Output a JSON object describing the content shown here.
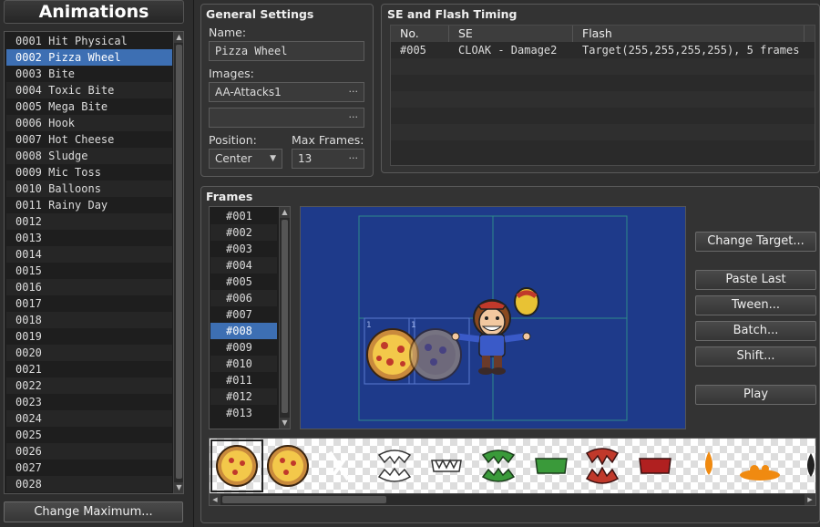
{
  "animations": {
    "header": "Animations",
    "selected_index": 1,
    "items": [
      "0001 Hit Physical",
      "0002 Pizza Wheel",
      "0003 Bite",
      "0004 Toxic Bite",
      "0005 Mega Bite",
      "0006 Hook",
      "0007 Hot Cheese",
      "0008 Sludge",
      "0009 Mic Toss",
      "0010 Balloons",
      "0011 Rainy Day",
      "0012",
      "0013",
      "0014",
      "0015",
      "0016",
      "0017",
      "0018",
      "0019",
      "0020",
      "0021",
      "0022",
      "0023",
      "0024",
      "0025",
      "0026",
      "0027",
      "0028"
    ],
    "change_maximum_label": "Change Maximum..."
  },
  "general": {
    "title": "General Settings",
    "name_label": "Name:",
    "name_value": "Pizza Wheel",
    "images_label": "Images:",
    "image1_value": "AA-Attacks1",
    "image2_value": "",
    "position_label": "Position:",
    "position_value": "Center",
    "max_frames_label": "Max Frames:",
    "max_frames_value": "13"
  },
  "se_flash": {
    "title": "SE and Flash Timing",
    "columns": [
      "No.",
      "SE",
      "Flash"
    ],
    "rows": [
      {
        "no": "#005",
        "se": "CLOAK - Damage2",
        "flash": "Target(255,255,255,255), 5 frames"
      }
    ]
  },
  "frames": {
    "title": "Frames",
    "selected_index": 7,
    "items": [
      "#001",
      "#002",
      "#003",
      "#004",
      "#005",
      "#006",
      "#007",
      "#008",
      "#009",
      "#010",
      "#011",
      "#012",
      "#013"
    ],
    "cell_labels": [
      "1",
      "1"
    ]
  },
  "buttons": {
    "change_target": "Change Target...",
    "paste_last": "Paste Last",
    "tween": "Tween...",
    "batch": "Batch...",
    "shift": "Shift...",
    "play": "Play"
  },
  "colors": {
    "accent": "#3d6fb3",
    "canvas_bg": "#1e3a8a"
  }
}
